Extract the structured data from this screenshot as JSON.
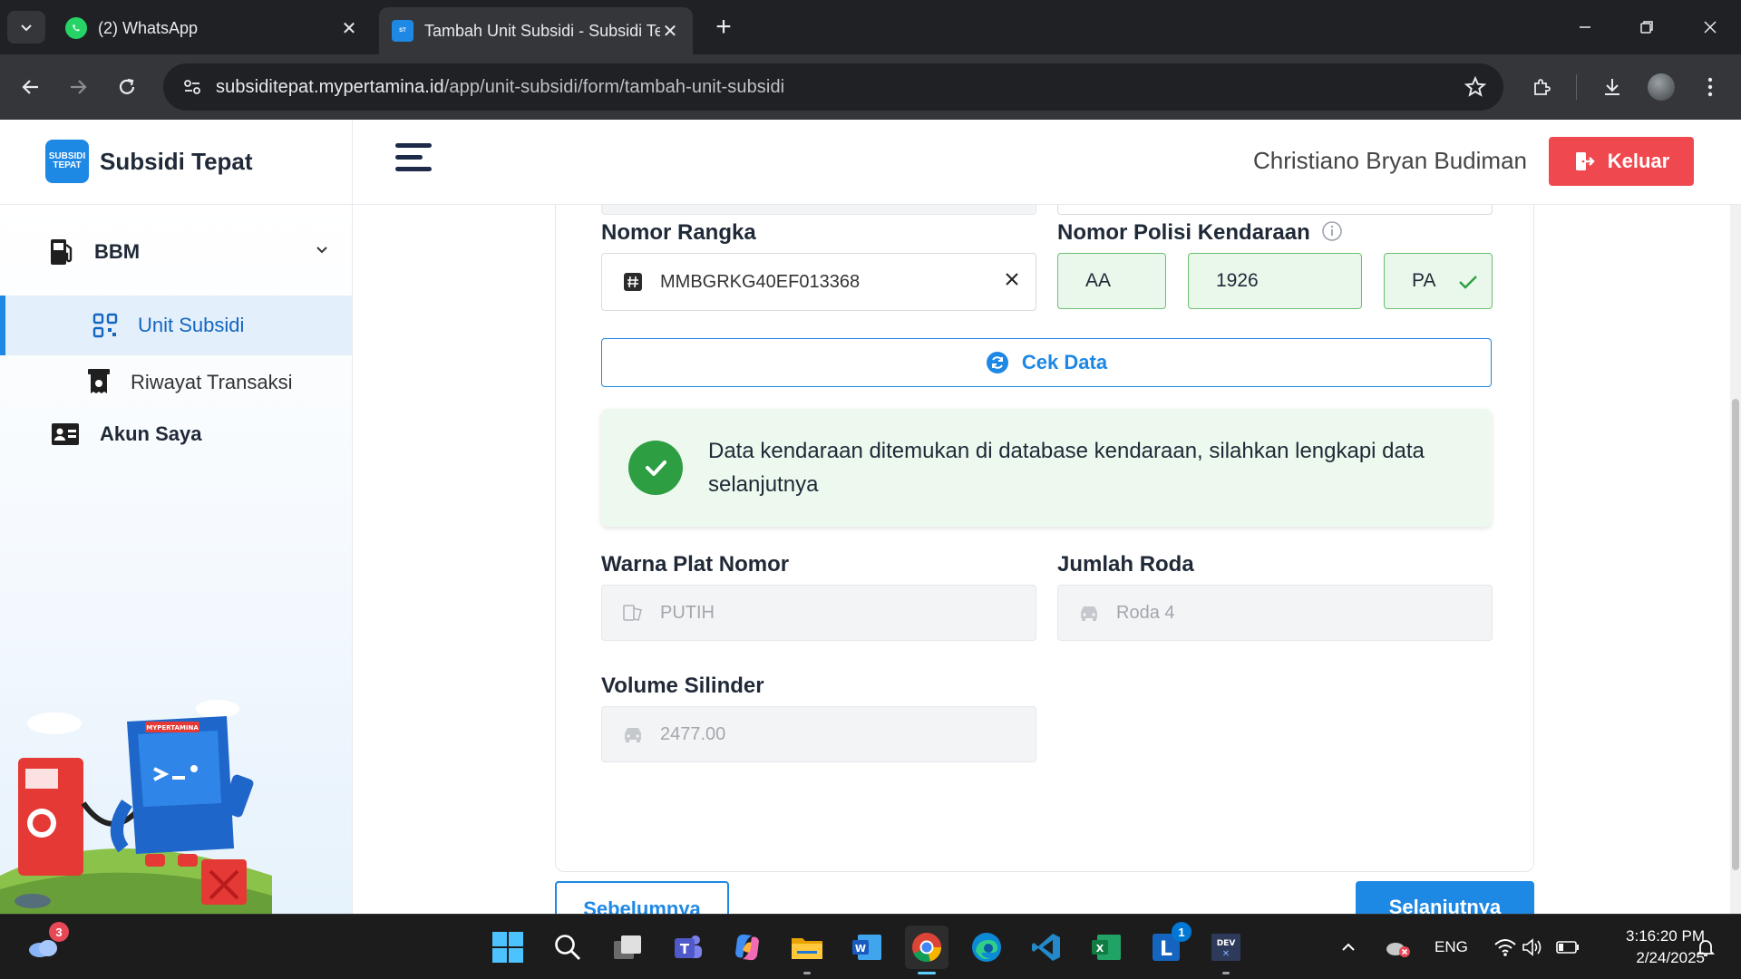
{
  "browser": {
    "tabs": [
      {
        "title": "(2) WhatsApp",
        "active": false
      },
      {
        "title": "Tambah Unit Subsidi - Subsidi Tepat",
        "active": true
      }
    ],
    "url_host": "subsiditepat.mypertamina.id",
    "url_path": "/app/unit-subsidi/form/tambah-unit-subsidi"
  },
  "header": {
    "brand_logo_line1": "SUBSIDI",
    "brand_logo_line2": "TEPAT",
    "brand_name": "Subsidi Tepat",
    "user_name": "Christiano Bryan Budiman",
    "logout_label": "Keluar"
  },
  "sidebar": {
    "items": [
      {
        "label": "BBM"
      },
      {
        "label": "Unit Subsidi"
      },
      {
        "label": "Riwayat Transaksi"
      },
      {
        "label": "Akun Saya"
      }
    ],
    "mascot_brand": "MYPERTAMINA"
  },
  "form": {
    "nomor_rangka": {
      "label": "Nomor Rangka",
      "value": "MMBGRKG40EF013368"
    },
    "nomor_polisi": {
      "label": "Nomor Polisi Kendaraan",
      "prefix": "AA",
      "number": "1926",
      "suffix": "PA"
    },
    "cek_data_label": "Cek Data",
    "alert_message": "Data kendaraan ditemukan di database kendaraan, silahkan lengkapi data selanjutnya",
    "warna_plat": {
      "label": "Warna Plat Nomor",
      "value": "PUTIH"
    },
    "jumlah_roda": {
      "label": "Jumlah Roda",
      "value": "Roda 4"
    },
    "volume_silinder": {
      "label": "Volume Silinder",
      "value": "2477.00"
    },
    "prev_label": "Sebelumnya",
    "next_label": "Selanjutnya"
  },
  "taskbar": {
    "weather_badge": "3",
    "lync_badge": "1",
    "language": "ENG",
    "time": "3:16:20 PM",
    "date": "2/24/2025"
  },
  "colors": {
    "primary": "#1e88e5",
    "danger": "#f0484f",
    "success": "#2e9e43",
    "success_bg": "#edf9ee"
  }
}
